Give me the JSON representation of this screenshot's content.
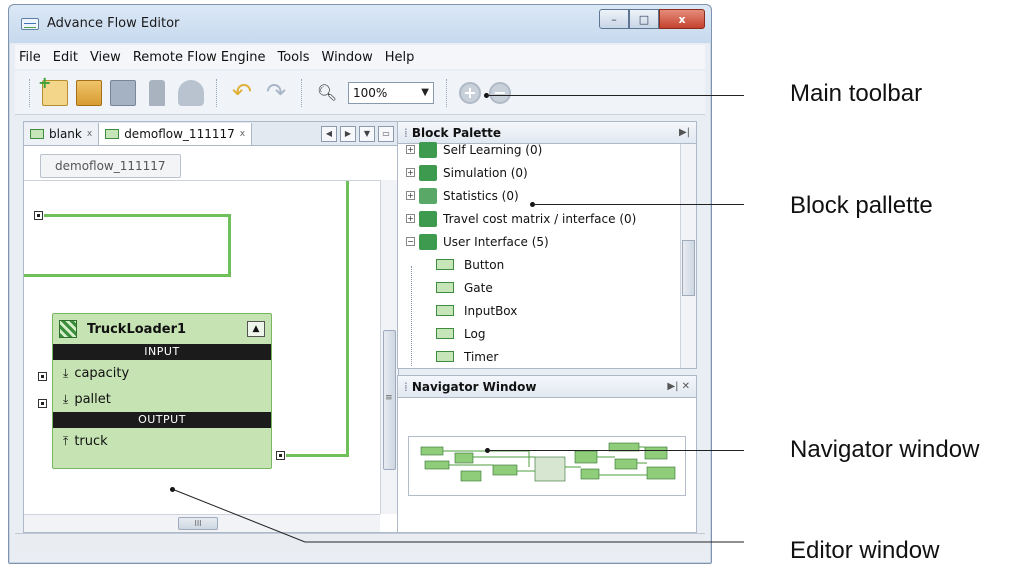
{
  "window": {
    "title": "Advance Flow Editor",
    "controls": {
      "minimize": "–",
      "maximize": "□",
      "close": "x"
    }
  },
  "menu": [
    "File",
    "Edit",
    "View",
    "Remote Flow Engine",
    "Tools",
    "Window",
    "Help"
  ],
  "toolbar": {
    "zoom_value": "100%",
    "icons": [
      "new-flow-icon",
      "open-folder-icon",
      "save-icon",
      "build-icon",
      "run-icon",
      "undo-icon",
      "redo-icon",
      "zoom-icon",
      "zoom-in-icon",
      "zoom-out-icon"
    ]
  },
  "editor": {
    "tabs": [
      {
        "label": "blank",
        "close": "x"
      },
      {
        "label": "demoflow_111117",
        "close": "x"
      }
    ],
    "breadcrumb": "demoflow_111117",
    "block": {
      "title": "TruckLoader1",
      "input_header": "INPUT",
      "inputs": [
        "capacity",
        "pallet"
      ],
      "output_header": "OUTPUT",
      "outputs": [
        "truck"
      ]
    },
    "hscroll_grip": "III",
    "vscroll_grip": "≡"
  },
  "block_palette": {
    "title": "Block Palette",
    "categories": [
      {
        "label": "Self Learning (0)",
        "expander": "+"
      },
      {
        "label": "Simulation (0)",
        "expander": "+"
      },
      {
        "label": "Statistics (0)",
        "expander": "+"
      },
      {
        "label": "Travel cost matrix / interface (0)",
        "expander": "+"
      },
      {
        "label": "User Interface (5)",
        "expander": "−"
      }
    ],
    "items": [
      "Button",
      "Gate",
      "InputBox",
      "Log",
      "Timer"
    ]
  },
  "navigator": {
    "title": "Navigator Window"
  },
  "annotations": [
    "Main toolbar",
    "Block pallette",
    "Navigator window",
    "Editor window"
  ],
  "colors": {
    "block_fill": "#c6e3b3",
    "connection": "#6fc05a",
    "close_button": "#c4422d"
  }
}
